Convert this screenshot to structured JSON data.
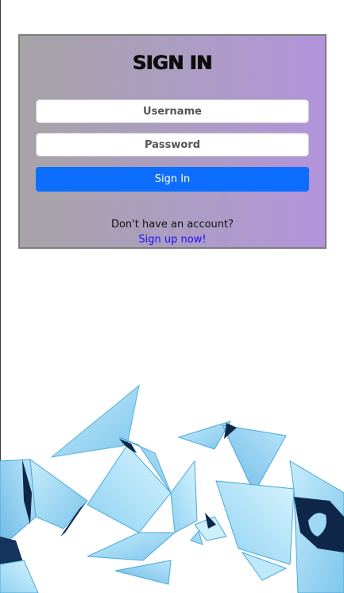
{
  "login": {
    "title": "SIGN IN",
    "username_placeholder": "Username",
    "password_placeholder": "Password",
    "submit_label": "Sign In",
    "signup_prompt": "Don't have an account?",
    "signup_link": "Sign up now!"
  },
  "colors": {
    "primary_button": "#0d6efd",
    "link": "#1a0dff",
    "card_gradient_start": "#a7a3a7",
    "card_gradient_end": "#b393dc",
    "shard_light": "#9fd8f4",
    "shard_dark": "#0e2748"
  },
  "decoration": {
    "background_art": "blue-glass-shards-illustration"
  }
}
